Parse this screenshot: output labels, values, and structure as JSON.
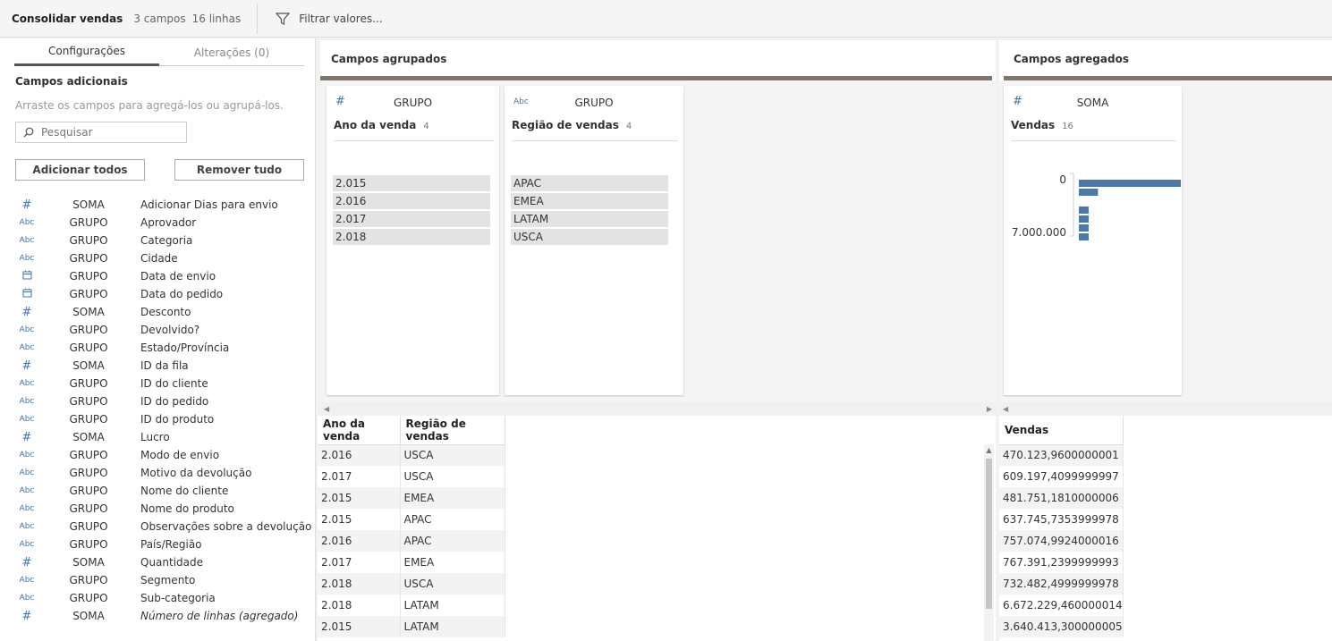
{
  "header": {
    "title": "Consolidar vendas",
    "fields_count": "3 campos",
    "rows_count": "16 linhas",
    "filter_label": "Filtrar valores..."
  },
  "left_panel": {
    "tabs": [
      {
        "label": "Configurações",
        "active": true
      },
      {
        "label": "Alterações (0)",
        "active": false
      }
    ],
    "heading": "Campos adicionais",
    "hint": "Arraste os campos para agregá-los ou agrupá-los.",
    "search_placeholder": "Pesquisar",
    "add_all_label": "Adicionar todos",
    "remove_all_label": "Remover tudo",
    "fields": [
      {
        "icon": "#",
        "type": "SOMA",
        "name": "Adicionar Dias para envio"
      },
      {
        "icon": "Abc",
        "type": "GRUPO",
        "name": "Aprovador"
      },
      {
        "icon": "Abc",
        "type": "GRUPO",
        "name": "Categoria"
      },
      {
        "icon": "Abc",
        "type": "GRUPO",
        "name": "Cidade"
      },
      {
        "icon": "cal",
        "type": "GRUPO",
        "name": "Data de envio"
      },
      {
        "icon": "cal",
        "type": "GRUPO",
        "name": "Data do pedido"
      },
      {
        "icon": "#",
        "type": "SOMA",
        "name": "Desconto"
      },
      {
        "icon": "Abc",
        "type": "GRUPO",
        "name": "Devolvido?"
      },
      {
        "icon": "Abc",
        "type": "GRUPO",
        "name": "Estado/Província"
      },
      {
        "icon": "#",
        "type": "SOMA",
        "name": "ID da fila"
      },
      {
        "icon": "Abc",
        "type": "GRUPO",
        "name": "ID do cliente"
      },
      {
        "icon": "Abc",
        "type": "GRUPO",
        "name": "ID do pedido"
      },
      {
        "icon": "Abc",
        "type": "GRUPO",
        "name": "ID do produto"
      },
      {
        "icon": "#",
        "type": "SOMA",
        "name": "Lucro"
      },
      {
        "icon": "Abc",
        "type": "GRUPO",
        "name": "Modo de envio"
      },
      {
        "icon": "Abc",
        "type": "GRUPO",
        "name": "Motivo da devolução"
      },
      {
        "icon": "Abc",
        "type": "GRUPO",
        "name": "Nome do cliente"
      },
      {
        "icon": "Abc",
        "type": "GRUPO",
        "name": "Nome do produto"
      },
      {
        "icon": "Abc",
        "type": "GRUPO",
        "name": "Observações sobre a devolução"
      },
      {
        "icon": "Abc",
        "type": "GRUPO",
        "name": "País/Região"
      },
      {
        "icon": "#",
        "type": "SOMA",
        "name": "Quantidade"
      },
      {
        "icon": "Abc",
        "type": "GRUPO",
        "name": "Segmento"
      },
      {
        "icon": "Abc",
        "type": "GRUPO",
        "name": "Sub-categoria"
      },
      {
        "icon": "#",
        "type": "SOMA",
        "name": "Número de linhas (agregado)",
        "italic": true
      }
    ]
  },
  "grouped": {
    "title": "Campos agrupados",
    "cards": [
      {
        "icon": "#",
        "type": "GRUPO",
        "name": "Ano da venda",
        "count": "4",
        "values": [
          "2.015",
          "2.016",
          "2.017",
          "2.018"
        ]
      },
      {
        "icon": "Abc",
        "type": "GRUPO",
        "name": "Região de vendas",
        "count": "4",
        "values": [
          "APAC",
          "EMEA",
          "LATAM",
          "USCA"
        ]
      }
    ]
  },
  "aggregated": {
    "title": "Campos agregados",
    "card": {
      "icon": "#",
      "type": "SOMA",
      "name": "Vendas",
      "count": "16",
      "axis_top": "0",
      "axis_bottom": "7.000.000"
    }
  },
  "chart_data": {
    "type": "bar",
    "orientation": "horizontal",
    "note_bins": [
      "0",
      "7.000.000"
    ],
    "values": [
      16,
      3,
      1,
      1,
      1,
      1
    ],
    "gaps_after": [
      1
    ]
  },
  "table": {
    "columns": [
      "Ano da venda",
      "Região de vendas"
    ],
    "rows": [
      [
        "2.016",
        "USCA"
      ],
      [
        "2.017",
        "USCA"
      ],
      [
        "2.015",
        "EMEA"
      ],
      [
        "2.015",
        "APAC"
      ],
      [
        "2.016",
        "APAC"
      ],
      [
        "2.017",
        "EMEA"
      ],
      [
        "2.018",
        "USCA"
      ],
      [
        "2.018",
        "LATAM"
      ],
      [
        "2.015",
        "LATAM"
      ]
    ],
    "agg_column": "Vendas",
    "agg_rows": [
      "470.123,9600000001",
      "609.197,4099999997",
      "481.751,1810000006",
      "637.745,7353999978",
      "757.074,9924000016",
      "767.391,2399999993",
      "732.482,4999999978",
      "6.672.229,460000014",
      "3.640.413,300000005"
    ]
  },
  "colors": {
    "accent_bar": "#7f766b",
    "histogram_bar": "#4e79a7",
    "icon_blue": "#4a74a6"
  }
}
